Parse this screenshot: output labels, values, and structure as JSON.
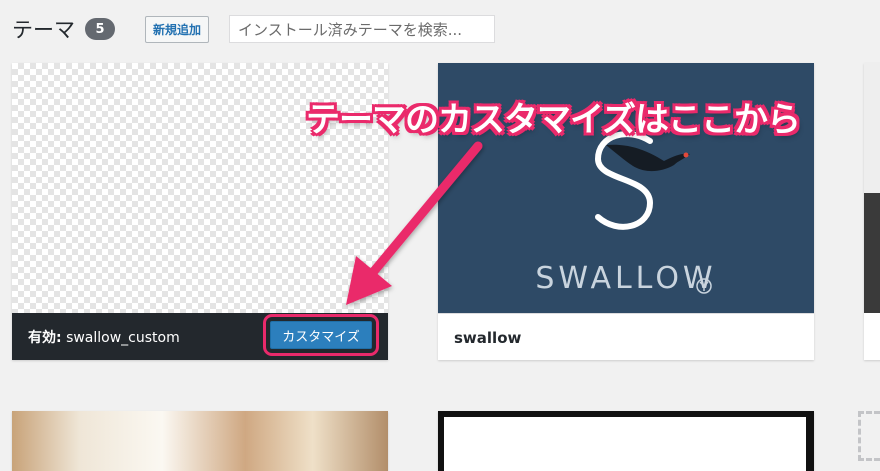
{
  "header": {
    "title": "テーマ",
    "count": "5",
    "add_new_label": "新規追加",
    "search_placeholder": "インストール済みテーマを検索..."
  },
  "themes": [
    {
      "status_label": "有効:",
      "name": "swallow_custom",
      "active": true,
      "customize_label": "カスタマイズ"
    },
    {
      "name": "swallow",
      "logo_text": "SWALLOW"
    }
  ],
  "annotation": {
    "text": "テーマのカスタマイズはここから",
    "color": "#ea2a6b"
  },
  "colors": {
    "accent": "#2c7fbd",
    "swallow_bg": "#2e4a66",
    "active_bar": "#23282d"
  }
}
